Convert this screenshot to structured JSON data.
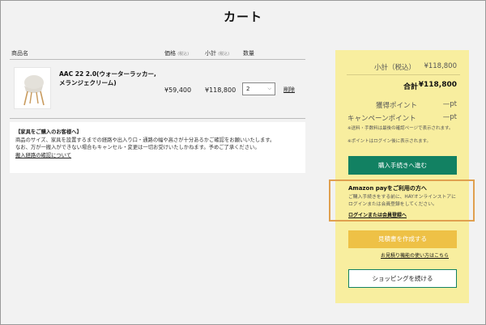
{
  "page": {
    "title": "カート"
  },
  "table": {
    "headers": {
      "product": "商品名",
      "price": "価格",
      "price_tax": "(税込)",
      "subtotal": "小計",
      "subtotal_tax": "(税込)",
      "quantity": "数量"
    }
  },
  "item": {
    "image": "chair-image",
    "name": "AAC 22 2.0(ウォーターラッカー, メランジェクリーム)",
    "price": "¥59,400",
    "subtotal": "¥118,800",
    "quantity": "2",
    "delete_label": "削除"
  },
  "notice": {
    "title": "【家具をご購入のお客様へ】",
    "line1": "商品のサイズ、家具を設置するまでの経路や出入り口・通路の幅や高さが十分あるかご確認をお願いいたします。",
    "line2": "なお、万が一搬入ができない場合もキャンセル・変更は一切お受けいたしかねます。予めご了承ください。",
    "link": "搬入経路の確認について"
  },
  "summary": {
    "subtotal_label": "小計（税込）",
    "subtotal_value": "¥118,800",
    "total_label": "合計",
    "total_value": "¥118,800",
    "points_label": "獲得ポイント",
    "points_value": "—pt",
    "campaign_label": "キャンペーンポイント",
    "campaign_value": "—pt",
    "note1": "※送料・手数料は最後の確認ページで表示されます。",
    "note2": "※ポイントはログイン後に表示されます。",
    "checkout_label": "購入手続きへ進む",
    "amazon_title": "Amazon payをご利用の方へ",
    "amazon_text": "ご購入手続きをする前に、HAYオンラインストアにログインまたは会員登録をしてください。",
    "amazon_link": "ログインまたは会員登録へ",
    "estimate_label": "見積書を作成する",
    "estimate_guide": "お見積り機能の使い方はこちら",
    "continue_label": "ショッピングを続ける"
  },
  "colors": {
    "summary_bg": "#f8ee9f",
    "primary_green": "#128162",
    "estimate_yellow": "#eec146",
    "highlight_orange": "#e0a04f"
  }
}
